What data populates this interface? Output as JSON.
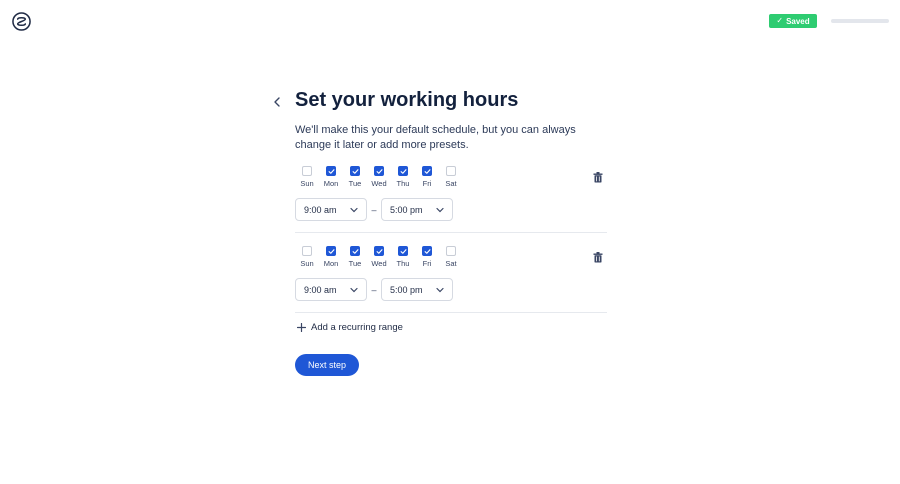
{
  "header": {
    "saved_label": "Saved",
    "progress_fraction": 0.0,
    "accent_color": "#1f57d6",
    "saved_color": "#2ecc71"
  },
  "page": {
    "title": "Set your working hours",
    "description": "We'll make this your default schedule, but you can always change it later or add more presets."
  },
  "ranges": [
    {
      "days": [
        {
          "label": "Sun",
          "checked": false
        },
        {
          "label": "Mon",
          "checked": true
        },
        {
          "label": "Tue",
          "checked": true
        },
        {
          "label": "Wed",
          "checked": true
        },
        {
          "label": "Thu",
          "checked": true
        },
        {
          "label": "Fri",
          "checked": true
        },
        {
          "label": "Sat",
          "checked": false
        }
      ],
      "start": "9:00 am",
      "separator": "–",
      "end": "5:00 pm"
    },
    {
      "days": [
        {
          "label": "Sun",
          "checked": false
        },
        {
          "label": "Mon",
          "checked": true
        },
        {
          "label": "Tue",
          "checked": true
        },
        {
          "label": "Wed",
          "checked": true
        },
        {
          "label": "Thu",
          "checked": true
        },
        {
          "label": "Fri",
          "checked": true
        },
        {
          "label": "Sat",
          "checked": false
        }
      ],
      "start": "9:00 am",
      "separator": "–",
      "end": "5:00 pm"
    }
  ],
  "actions": {
    "add_range_label": "Add a recurring range",
    "next_label": "Next step"
  },
  "icons": {
    "logo": "spiral-logo-icon",
    "back": "chevron-left-icon",
    "delete": "trash-icon",
    "add": "plus-icon",
    "dropdown": "chevron-down-icon",
    "saved": "check-icon"
  }
}
